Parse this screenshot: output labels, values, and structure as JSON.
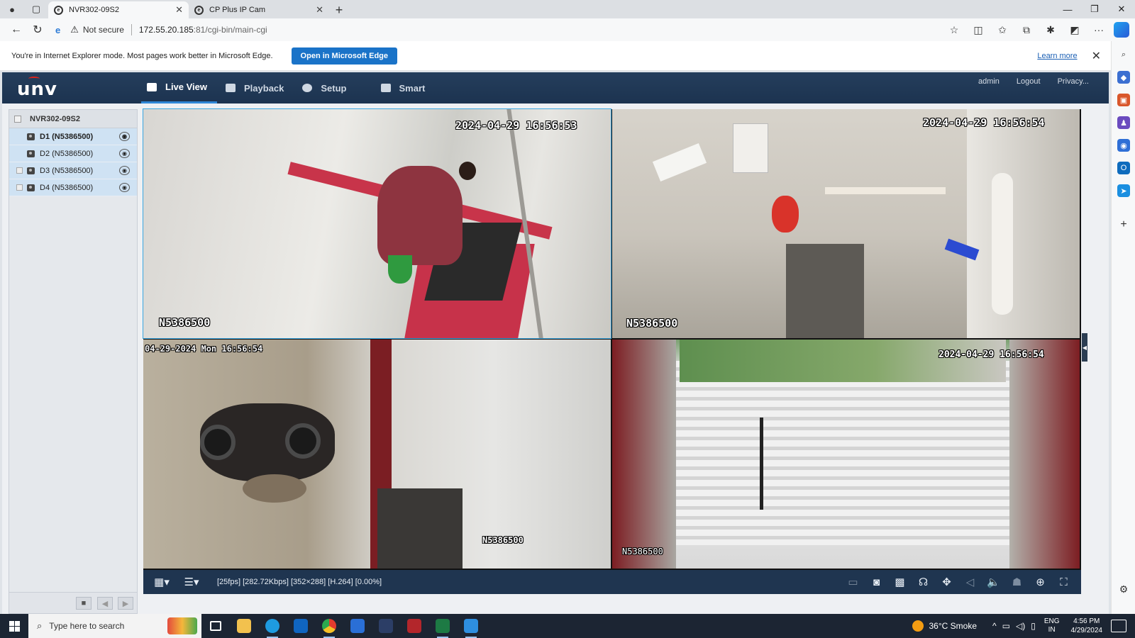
{
  "browser": {
    "tabs": [
      {
        "title": "NVR302-09S2",
        "active": true
      },
      {
        "title": "CP Plus IP Cam",
        "active": false
      }
    ],
    "address": {
      "security_label": "Not secure",
      "url_host": "172.55.20.185",
      "url_path": ":81/cgi-bin/main-cgi"
    },
    "ie_banner": {
      "message": "You're in Internet Explorer mode. Most pages work better in Microsoft Edge.",
      "open_button": "Open in Microsoft Edge",
      "learn_more": "Learn more"
    }
  },
  "app": {
    "logo": "unv",
    "menu": [
      {
        "label": "Live View",
        "icon": "monitor-icon",
        "active": true
      },
      {
        "label": "Playback",
        "icon": "film-icon",
        "active": false
      },
      {
        "label": "Setup",
        "icon": "gear-icon",
        "active": false
      },
      {
        "label": "Smart",
        "icon": "person-icon",
        "active": false
      }
    ],
    "user_links": {
      "user": "admin",
      "logout": "Logout",
      "privacy": "Privacy..."
    },
    "device_tree": {
      "root": "NVR302-09S2",
      "cameras": [
        {
          "label": "D1 (N5386500)",
          "selected": true
        },
        {
          "label": "D2 (N5386500)",
          "selected": false
        },
        {
          "label": "D3 (N5386500)",
          "selected": false
        },
        {
          "label": "D4 (N5386500)",
          "selected": false
        }
      ]
    },
    "tiles": [
      {
        "timestamp": "2024-04-29 16:56:53",
        "camera_name": "N5386500"
      },
      {
        "timestamp": "2024-04-29 16:56:54",
        "camera_name": "N5386500"
      },
      {
        "timestamp": "04-29-2024 Mon 16:56:54",
        "camera_name": "N5386500"
      },
      {
        "timestamp": "2024-04-29  16:56:54",
        "camera_name": "N5386500"
      }
    ],
    "stream_info": "[25fps] [282.72Kbps] [352×288] [H.264] [0.00%]"
  },
  "taskbar": {
    "search_placeholder": "Type here to search",
    "weather": "36°C  Smoke",
    "language": {
      "line1": "ENG",
      "line2": "IN"
    },
    "clock": {
      "time": "4:56 PM",
      "date": "4/29/2024"
    }
  },
  "colors": {
    "accent": "#2f87d6",
    "header": "#1f3550",
    "selected_row": "#cfe2f3"
  }
}
